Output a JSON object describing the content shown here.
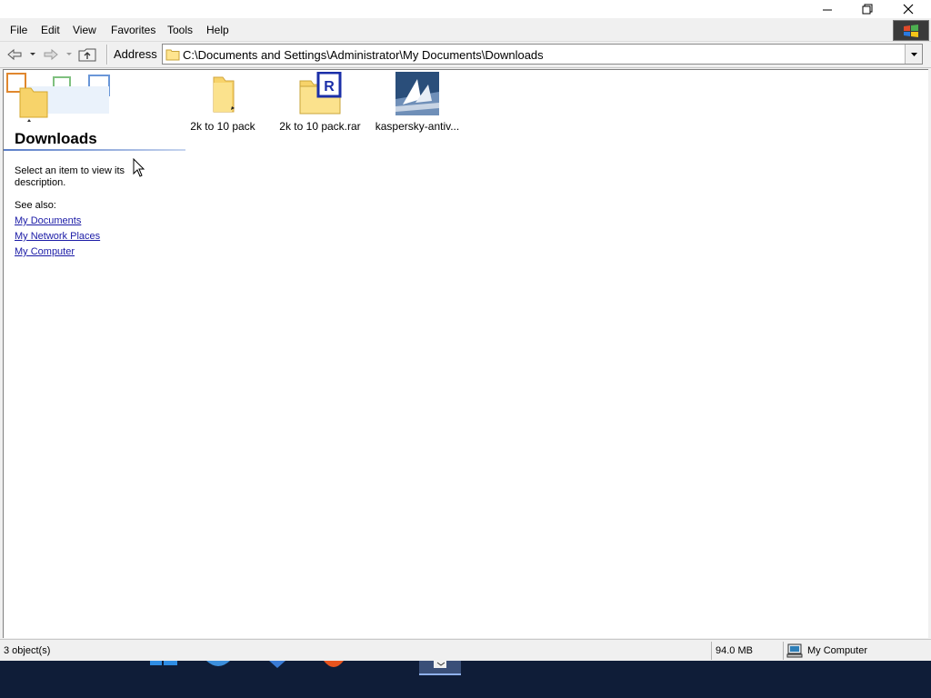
{
  "titlebar": {
    "minimize_icon": "minimize-icon",
    "restore_icon": "restore-icon",
    "close_icon": "close-icon"
  },
  "menu": {
    "items": [
      "File",
      "Edit",
      "View",
      "Favorites",
      "Tools",
      "Help"
    ]
  },
  "toolbar": {
    "address_label": "Address",
    "address_value": "C:\\Documents and Settings\\Administrator\\My Documents\\Downloads",
    "icons": [
      "back-icon",
      "forward-icon",
      "up-folder-icon"
    ]
  },
  "left_panel": {
    "title": "Downloads",
    "description": "Select an item to view its description.",
    "see_also_label": "See also:",
    "links": [
      "My Documents",
      "My Network Places",
      "My Computer"
    ]
  },
  "files": [
    {
      "label": "2k to 10 pack",
      "icon": "folder-icon"
    },
    {
      "label": "2k to 10 pack.rar",
      "icon": "winrar-archive-icon"
    },
    {
      "label": "kaspersky-antiv...",
      "icon": "kaspersky-installer-icon"
    }
  ],
  "statusbar": {
    "objects": "3 object(s)",
    "size": "94.0 MB",
    "location": "My Computer"
  },
  "colors": {
    "taskbar": "#0f1d38",
    "link": "#1a1aa6",
    "panel_rule": "#5a7ec8"
  }
}
